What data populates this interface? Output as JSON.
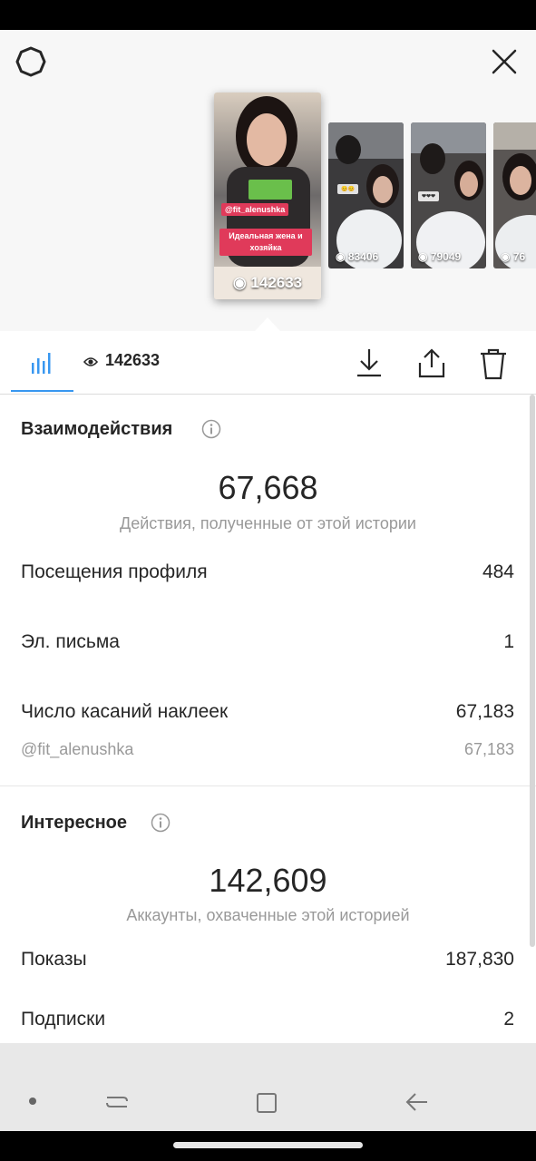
{
  "colors": {
    "accent": "#3897f0",
    "text": "#262626",
    "muted": "#999999",
    "tag_pink": "#e03a5a",
    "tag_green": "#6abf4b"
  },
  "stories": {
    "selected": {
      "views": "142633",
      "sticker_mention": "@fit_alenushka",
      "sticker_caption": "Идеальная жена и хозяйка"
    },
    "thumbnails": [
      {
        "views": "83406"
      },
      {
        "views": "79049"
      },
      {
        "views": "76"
      }
    ]
  },
  "tabs": {
    "views_label": "142633",
    "icons": [
      "insights-icon",
      "eye-icon",
      "download-icon",
      "share-icon",
      "trash-icon"
    ]
  },
  "interactions": {
    "title": "Взаимодействия",
    "total": "67,668",
    "caption": "Действия, полученные от этой истории",
    "rows": [
      {
        "label": "Посещения профиля",
        "value": "484"
      },
      {
        "label": "Эл. письма",
        "value": "1"
      },
      {
        "label": "Число касаний наклеек",
        "value": "67,183"
      }
    ],
    "sub_row": {
      "label": "@fit_alenushka",
      "value": "67,183"
    }
  },
  "discovery": {
    "title": "Интересное",
    "total": "142,609",
    "caption": "Аккаунты, охваченные этой историей",
    "rows": [
      {
        "label": "Показы",
        "value": "187,830"
      },
      {
        "label": "Подписки",
        "value": "2"
      }
    ]
  }
}
